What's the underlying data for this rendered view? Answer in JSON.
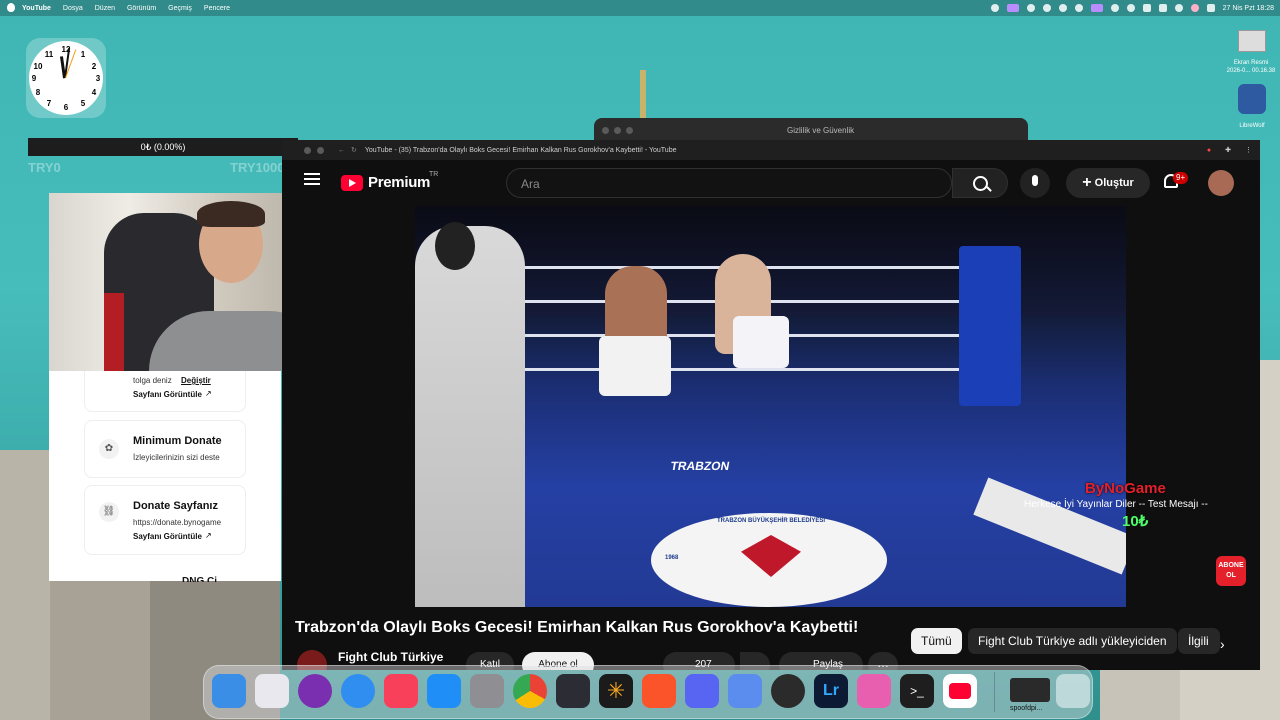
{
  "menubar": {
    "app_name": "YouTube",
    "menus": [
      "Dosya",
      "Düzen",
      "Görünüm",
      "Geçmiş",
      "Pencere"
    ],
    "datetime": "27 Nis Pzt  18:28"
  },
  "clock": {
    "numbers": [
      "12",
      "1",
      "2",
      "3",
      "4",
      "5",
      "6",
      "7",
      "8",
      "9",
      "10",
      "11"
    ]
  },
  "donation_bar": {
    "text": "0₺ (0.00%)",
    "left_label": "TRY0",
    "right_label": "TRY1000"
  },
  "panel": {
    "user_name": "tolga deniz",
    "change_link": "Değiştir",
    "view_page": "Sayfanı Görüntüle",
    "min_title": "Minimum Donate",
    "min_desc": "İzleyicilerinizin sizi deste",
    "page_title": "Donate Sayfanız",
    "page_url": "https://donate.bynogame",
    "view_page2": "Sayfanı Görüntüle",
    "next_card": "DNG Ci..."
  },
  "background_window": {
    "title": "Gizlilik ve Güvenlik"
  },
  "browser": {
    "tab_title": "YouTube - (35) Trabzon'da Olaylı Boks Gecesi! Emirhan Kalkan Rus Gorokhov'a Kaybetti! - YouTube"
  },
  "youtube": {
    "logo": "Premium",
    "region": "TR",
    "search_placeholder": "Ara",
    "create_label": "Oluştur",
    "notif_badge": "9+"
  },
  "overlay": {
    "brand": "ByNoGame",
    "message": "Herkese İyi Yayınlar Diler -- Test Mesajı --",
    "amount": "10₺",
    "subscribe": "ABONE OL"
  },
  "video": {
    "title": "Trabzon'da Olaylı Boks Gecesi! Emirhan Kalkan Rus Gorokhov'a Kaybetti!",
    "channel": "Fight Club Türkiye",
    "join": "Katıl",
    "subscribe": "Abone ol",
    "likes": "207",
    "share": "Paylaş",
    "ring_logo_text": "TRABZON BÜYÜKŞEHİR BELEDİYESİ",
    "ring_year": "1968",
    "mat_text": "TRABZON"
  },
  "chips": [
    "Tümü",
    "Fight Club Türkiye adlı yükleyiciden",
    "İlgili"
  ],
  "dock": {
    "file_label": "spoofdpi..."
  },
  "desktop": {
    "file1": "Ekran Resmi",
    "file1_sub": "2026-0... 00.16.38",
    "file2": "LibreWolf"
  },
  "colors": {
    "yt_red": "#ff0033",
    "menubar_text": "#ffffff",
    "bynogame_red": "#e4202a"
  }
}
